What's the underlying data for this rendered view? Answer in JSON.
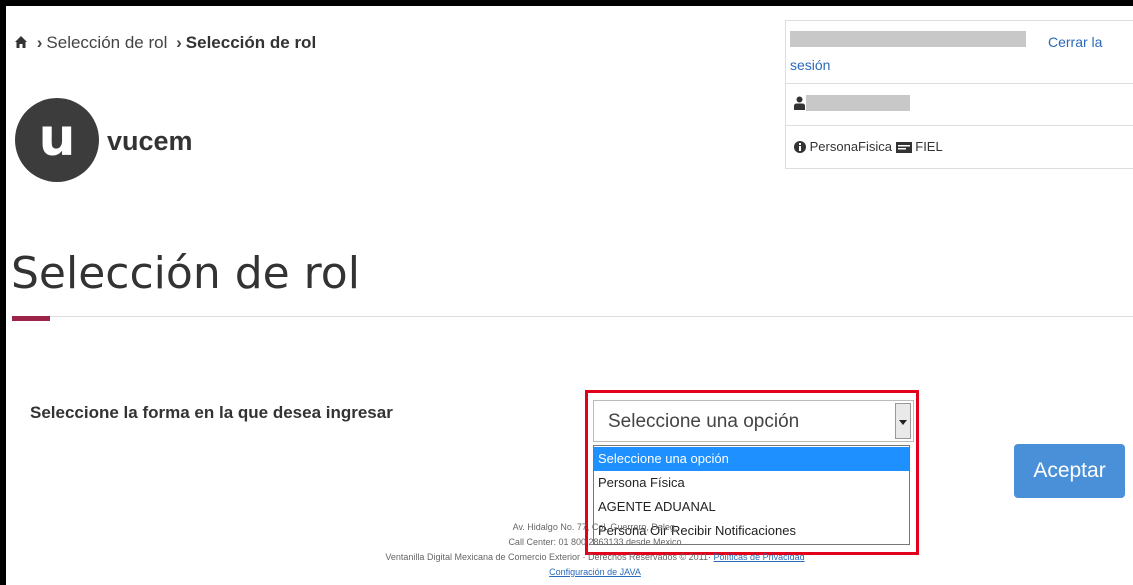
{
  "breadcrumb": {
    "home_icon": "home-icon",
    "item1": "Selección de rol",
    "item2": "Selección de rol"
  },
  "logo": {
    "letter": "u",
    "name": "vucem"
  },
  "user_panel": {
    "logout_line1": "Cerrar la",
    "logout_line2": "sesión",
    "user_icon": "user-icon",
    "persona": "PersonaFisica",
    "cert": "FIEL",
    "info_icon": "info-circle-icon",
    "card_icon": "id-card-icon"
  },
  "page": {
    "title": "Selección de rol",
    "accent_color": "#9d2449"
  },
  "form": {
    "label": "Seleccione la forma en la que desea ingresar",
    "select_value": "Seleccione una opción",
    "options": [
      "Seleccione una opción",
      "Persona Física",
      "AGENTE ADUANAL",
      "Persona Oir Recibir Notificaciones"
    ],
    "accept_label": "Aceptar",
    "highlight_color": "#e2001a"
  },
  "footer": {
    "line1": "Av. Hidalgo No. 77, Col. Guerrero, Deleg.",
    "line2": "Call Center: 01 800 2863133 desde Mexico",
    "line3_prefix": "Ventanilla Digital Mexicana de Comercio Exterior · Derechos Reservados © 2011·",
    "privacy": "Políticas de Privacidad",
    "java": "Configuración de JAVA"
  }
}
